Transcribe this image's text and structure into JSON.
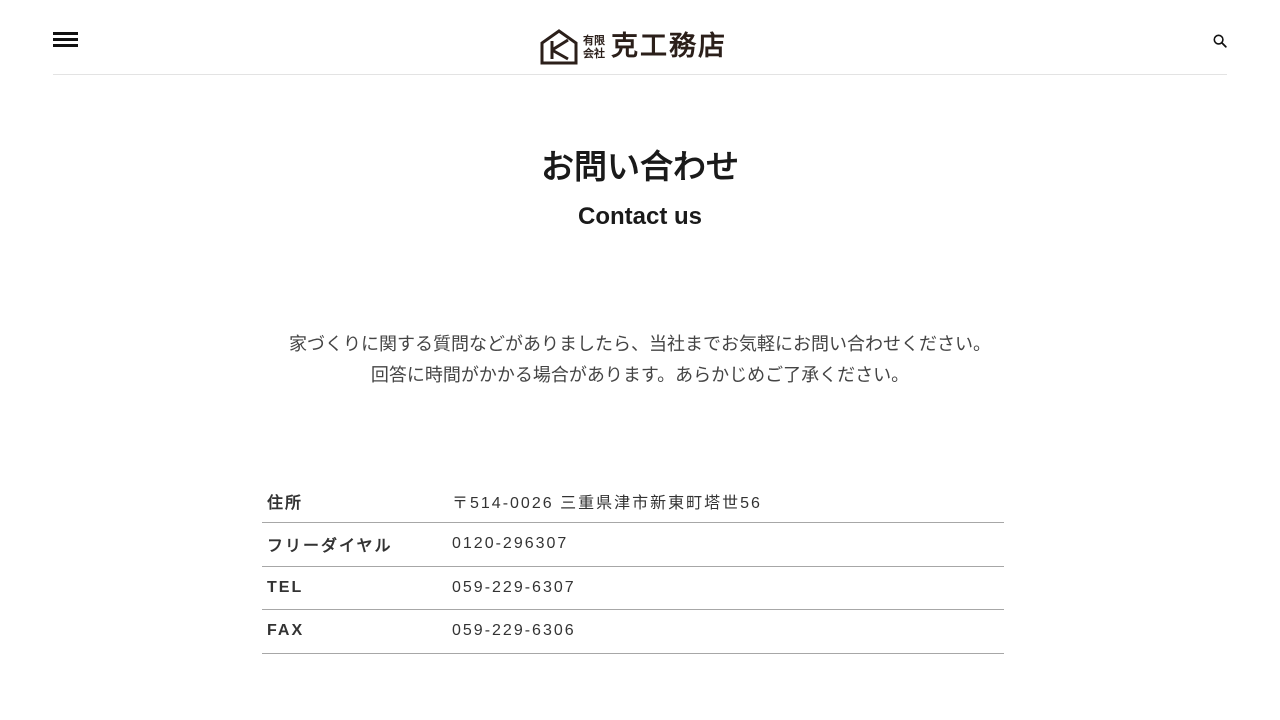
{
  "header": {
    "logo": {
      "small_line1": "有限",
      "small_line2": "会社",
      "large": "克工務店"
    },
    "menu_icon": "hamburger-icon",
    "search_icon": "search-icon"
  },
  "page": {
    "title_ja": "お問い合わせ",
    "title_en": "Contact us",
    "intro_line1": "家づくりに関する質問などがありましたら、当社までお気軽にお問い合わせください。",
    "intro_line2": "回答に時間がかかる場合があります。あらかじめご了承ください。"
  },
  "info": [
    {
      "label": "住所",
      "value": "〒514-0026 三重県津市新東町塔世56"
    },
    {
      "label": "フリーダイヤル",
      "value": "0120-296307"
    },
    {
      "label": "TEL",
      "value": "059-229-6307"
    },
    {
      "label": "FAX",
      "value": "059-229-6306"
    }
  ],
  "colors": {
    "text": "#222222",
    "logo": "#2b1f1a",
    "divider": "#a7a7a7"
  }
}
